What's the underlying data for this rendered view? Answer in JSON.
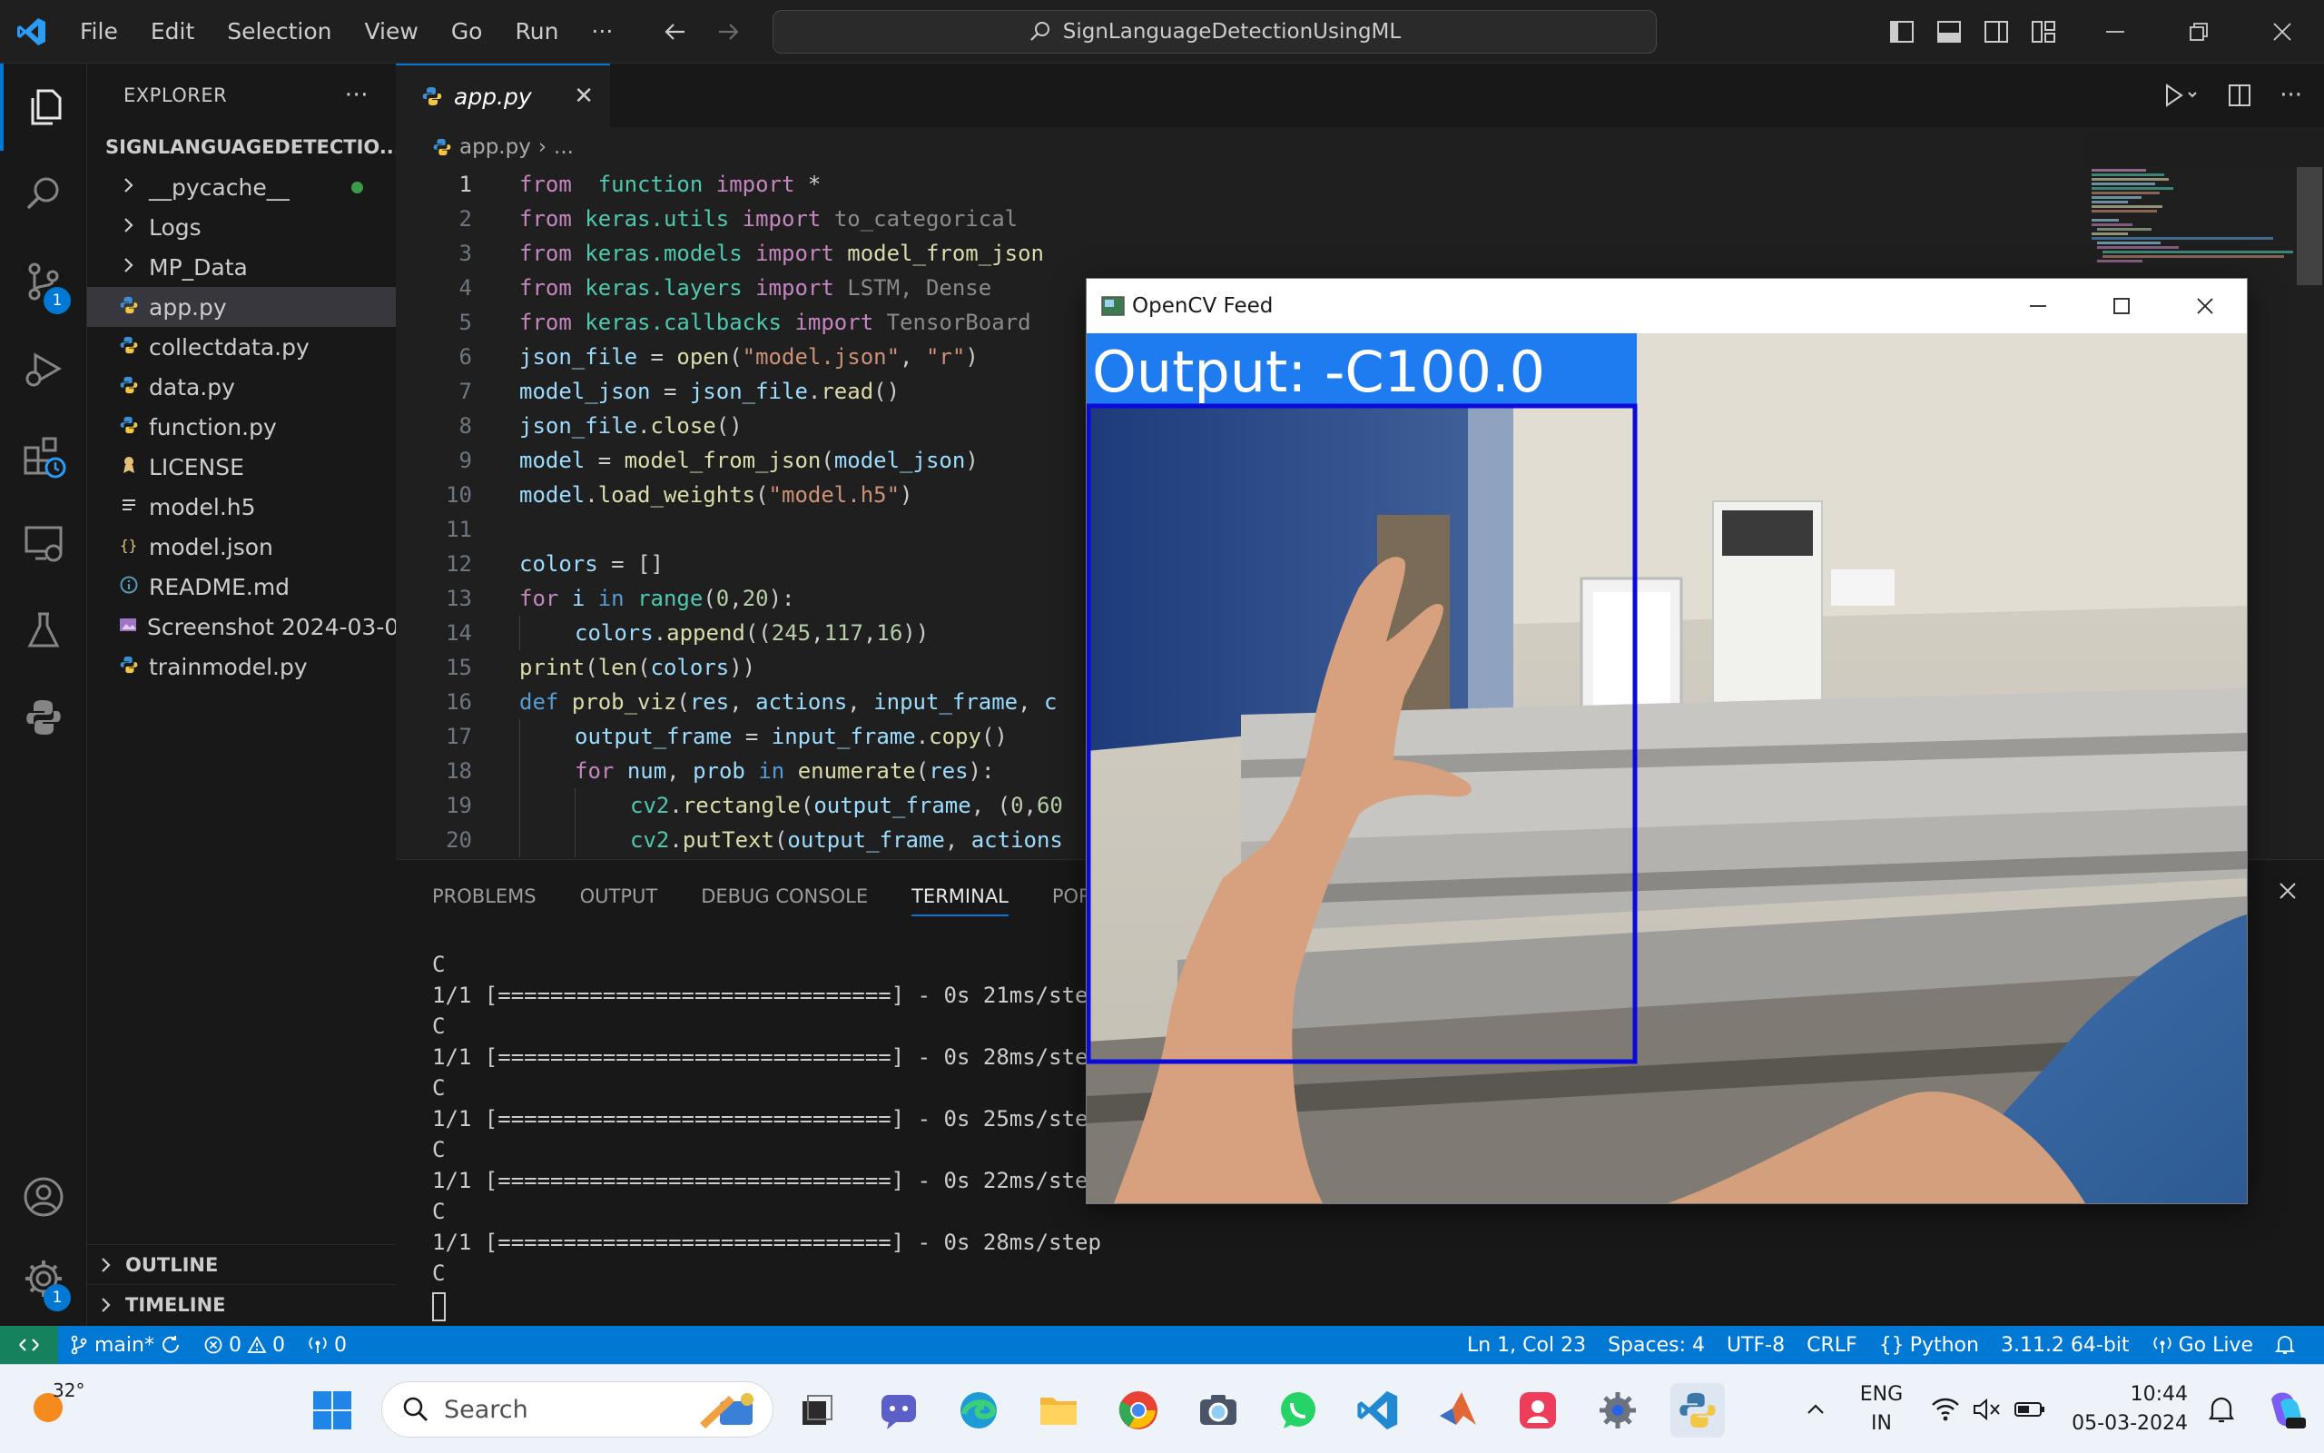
{
  "titlebar": {
    "menu": [
      "File",
      "Edit",
      "Selection",
      "View",
      "Go",
      "Run",
      "···"
    ],
    "search_text": "SignLanguageDetectionUsingML"
  },
  "activity": {
    "source_control_badge": "1",
    "accounts_badge": "1"
  },
  "sidebar": {
    "title": "EXPLORER",
    "more": "···",
    "folder": "SIGNLANGUAGEDETECTIO...",
    "items": [
      {
        "label": "__pycache__",
        "icon": "chevron-right-icon",
        "type": "folder"
      },
      {
        "label": "Logs",
        "icon": "chevron-right-icon",
        "type": "folder"
      },
      {
        "label": "MP_Data",
        "icon": "chevron-right-icon",
        "type": "folder"
      },
      {
        "label": "app.py",
        "icon": "python-icon",
        "type": "file"
      },
      {
        "label": "collectdata.py",
        "icon": "python-icon",
        "type": "file"
      },
      {
        "label": "data.py",
        "icon": "python-icon",
        "type": "file"
      },
      {
        "label": "function.py",
        "icon": "python-icon",
        "type": "file"
      },
      {
        "label": "LICENSE",
        "icon": "license-icon",
        "type": "file"
      },
      {
        "label": "model.h5",
        "icon": "lines-icon",
        "type": "file"
      },
      {
        "label": "model.json",
        "icon": "json-icon",
        "type": "file"
      },
      {
        "label": "README.md",
        "icon": "info-icon",
        "type": "file"
      },
      {
        "label": "Screenshot 2024-03-0...",
        "icon": "image-icon",
        "type": "file"
      },
      {
        "label": "trainmodel.py",
        "icon": "python-icon",
        "type": "file"
      }
    ],
    "outline": "OUTLINE",
    "timeline": "TIMELINE"
  },
  "editor": {
    "tab": "app.py",
    "breadcrumb_file": "app.py",
    "breadcrumb_rest": "...",
    "lines": [
      {
        "n": "1",
        "indent": 0,
        "tokens": [
          [
            "kw",
            "from"
          ],
          [
            "",
            "  "
          ],
          [
            "mod",
            "function"
          ],
          [
            "",
            " "
          ],
          [
            "kw",
            "import"
          ],
          [
            "",
            " *"
          ]
        ]
      },
      {
        "n": "2",
        "indent": 0,
        "tokens": [
          [
            "kw",
            "from"
          ],
          [
            "",
            " "
          ],
          [
            "mod",
            "keras.utils"
          ],
          [
            "",
            " "
          ],
          [
            "kw",
            "import"
          ],
          [
            "",
            " "
          ],
          [
            "dim",
            "to_categorical"
          ]
        ]
      },
      {
        "n": "3",
        "indent": 0,
        "tokens": [
          [
            "kw",
            "from"
          ],
          [
            "",
            " "
          ],
          [
            "mod",
            "keras.models"
          ],
          [
            "",
            " "
          ],
          [
            "kw",
            "import"
          ],
          [
            "",
            " "
          ],
          [
            "fn",
            "model_from_json"
          ]
        ]
      },
      {
        "n": "4",
        "indent": 0,
        "tokens": [
          [
            "kw",
            "from"
          ],
          [
            "",
            " "
          ],
          [
            "mod",
            "keras.layers"
          ],
          [
            "",
            " "
          ],
          [
            "kw",
            "import"
          ],
          [
            "",
            " "
          ],
          [
            "dim",
            "LSTM, Dense"
          ]
        ]
      },
      {
        "n": "5",
        "indent": 0,
        "tokens": [
          [
            "kw",
            "from"
          ],
          [
            "",
            " "
          ],
          [
            "mod",
            "keras.callbacks"
          ],
          [
            "",
            " "
          ],
          [
            "kw",
            "import"
          ],
          [
            "",
            " "
          ],
          [
            "dim",
            "TensorBoard"
          ]
        ]
      },
      {
        "n": "6",
        "indent": 0,
        "tokens": [
          [
            "var",
            "json_file"
          ],
          [
            "",
            " = "
          ],
          [
            "fn",
            "open"
          ],
          [
            "",
            "("
          ],
          [
            "str",
            "\"model.json\""
          ],
          [
            "",
            ", "
          ],
          [
            "str",
            "\"r\""
          ],
          [
            "",
            ")"
          ]
        ]
      },
      {
        "n": "7",
        "indent": 0,
        "tokens": [
          [
            "var",
            "model_json"
          ],
          [
            "",
            " = "
          ],
          [
            "var",
            "json_file"
          ],
          [
            "",
            "."
          ],
          [
            "fn",
            "read"
          ],
          [
            "",
            "()"
          ]
        ]
      },
      {
        "n": "8",
        "indent": 0,
        "tokens": [
          [
            "var",
            "json_file"
          ],
          [
            "",
            "."
          ],
          [
            "fn",
            "close"
          ],
          [
            "",
            "()"
          ]
        ]
      },
      {
        "n": "9",
        "indent": 0,
        "tokens": [
          [
            "var",
            "model"
          ],
          [
            "",
            " = "
          ],
          [
            "fn",
            "model_from_json"
          ],
          [
            "",
            "("
          ],
          [
            "var",
            "model_json"
          ],
          [
            "",
            ")"
          ]
        ]
      },
      {
        "n": "10",
        "indent": 0,
        "tokens": [
          [
            "var",
            "model"
          ],
          [
            "",
            "."
          ],
          [
            "fn",
            "load_weights"
          ],
          [
            "",
            "("
          ],
          [
            "str",
            "\"model.h5\""
          ],
          [
            "",
            ")"
          ]
        ]
      },
      {
        "n": "11",
        "indent": 0,
        "tokens": []
      },
      {
        "n": "12",
        "indent": 0,
        "tokens": [
          [
            "var",
            "colors"
          ],
          [
            "",
            " = []"
          ]
        ]
      },
      {
        "n": "13",
        "indent": 0,
        "tokens": [
          [
            "kw",
            "for"
          ],
          [
            "",
            " "
          ],
          [
            "var",
            "i"
          ],
          [
            "",
            " "
          ],
          [
            "kw2",
            "in"
          ],
          [
            "",
            " "
          ],
          [
            "mod",
            "range"
          ],
          [
            "",
            "("
          ],
          [
            "num",
            "0"
          ],
          [
            "",
            ","
          ],
          [
            "num",
            "20"
          ],
          [
            "",
            "):"
          ]
        ]
      },
      {
        "n": "14",
        "indent": 1,
        "tokens": [
          [
            "var",
            "colors"
          ],
          [
            "",
            "."
          ],
          [
            "fn",
            "append"
          ],
          [
            "",
            "(("
          ],
          [
            "num",
            "245"
          ],
          [
            "",
            ","
          ],
          [
            "num",
            "117"
          ],
          [
            "",
            ","
          ],
          [
            "num",
            "16"
          ],
          [
            "",
            "))"
          ]
        ]
      },
      {
        "n": "15",
        "indent": 0,
        "tokens": [
          [
            "fn",
            "print"
          ],
          [
            "",
            "("
          ],
          [
            "fn",
            "len"
          ],
          [
            "",
            "("
          ],
          [
            "var",
            "colors"
          ],
          [
            "",
            "))"
          ]
        ]
      },
      {
        "n": "16",
        "indent": 0,
        "tokens": [
          [
            "kw2",
            "def"
          ],
          [
            "",
            " "
          ],
          [
            "fn",
            "prob_viz"
          ],
          [
            "",
            "("
          ],
          [
            "var",
            "res"
          ],
          [
            "",
            ", "
          ],
          [
            "var",
            "actions"
          ],
          [
            "",
            ", "
          ],
          [
            "var",
            "input_frame"
          ],
          [
            "",
            ", "
          ],
          [
            "var",
            "c"
          ]
        ]
      },
      {
        "n": "17",
        "indent": 1,
        "tokens": [
          [
            "var",
            "output_frame"
          ],
          [
            "",
            " = "
          ],
          [
            "var",
            "input_frame"
          ],
          [
            "",
            "."
          ],
          [
            "fn",
            "copy"
          ],
          [
            "",
            "()"
          ]
        ]
      },
      {
        "n": "18",
        "indent": 1,
        "tokens": [
          [
            "kw",
            "for"
          ],
          [
            "",
            " "
          ],
          [
            "var",
            "num"
          ],
          [
            "",
            ", "
          ],
          [
            "var",
            "prob"
          ],
          [
            "",
            " "
          ],
          [
            "kw2",
            "in"
          ],
          [
            "",
            " "
          ],
          [
            "fn",
            "enumerate"
          ],
          [
            "",
            "("
          ],
          [
            "var",
            "res"
          ],
          [
            "",
            "):"
          ]
        ]
      },
      {
        "n": "19",
        "indent": 2,
        "tokens": [
          [
            "mod",
            "cv2"
          ],
          [
            "",
            "."
          ],
          [
            "fn",
            "rectangle"
          ],
          [
            "",
            "("
          ],
          [
            "var",
            "output_frame"
          ],
          [
            "",
            ", ("
          ],
          [
            "num",
            "0"
          ],
          [
            "",
            ","
          ],
          [
            "num",
            "60"
          ]
        ]
      },
      {
        "n": "20",
        "indent": 2,
        "tokens": [
          [
            "mod",
            "cv2"
          ],
          [
            "",
            "."
          ],
          [
            "fn",
            "putText"
          ],
          [
            "",
            "("
          ],
          [
            "var",
            "output_frame"
          ],
          [
            "",
            ", "
          ],
          [
            "var",
            "actions"
          ]
        ]
      }
    ]
  },
  "panel": {
    "tabs": [
      "PROBLEMS",
      "OUTPUT",
      "DEBUG CONSOLE",
      "TERMINAL",
      "PORTS"
    ],
    "active_tab": "TERMINAL",
    "terminal": [
      "C",
      "1/1 [==============================] - 0s 21ms/step",
      "C",
      "1/1 [==============================] - 0s 28ms/step",
      "C",
      "1/1 [==============================] - 0s 25ms/step",
      "C",
      "1/1 [==============================] - 0s 22ms/step",
      "C",
      "1/1 [==============================] - 0s 28ms/step",
      "C"
    ]
  },
  "statusbar": {
    "branch": "main*",
    "errors": "0",
    "warnings": "0",
    "ports": "0",
    "position": "Ln 1, Col 23",
    "spaces": "Spaces: 4",
    "encoding": "UTF-8",
    "eol": "CRLF",
    "language": "Python",
    "interpreter": "3.11.2 64-bit",
    "golive": "Go Live"
  },
  "cv_window": {
    "title": "OpenCV Feed",
    "output_text": "Output: -C100.0"
  },
  "taskbar": {
    "weather": "32°",
    "search_placeholder": "Search",
    "lang_top": "ENG",
    "lang_bottom": "IN",
    "time": "10:44",
    "date": "05-03-2024"
  },
  "colors": {
    "accent": "#0078d4",
    "statusbar": "#0078d4",
    "remote": "#16825d",
    "cv_box": "#0a0adc",
    "cv_label_bg": "#1e7cf0"
  }
}
